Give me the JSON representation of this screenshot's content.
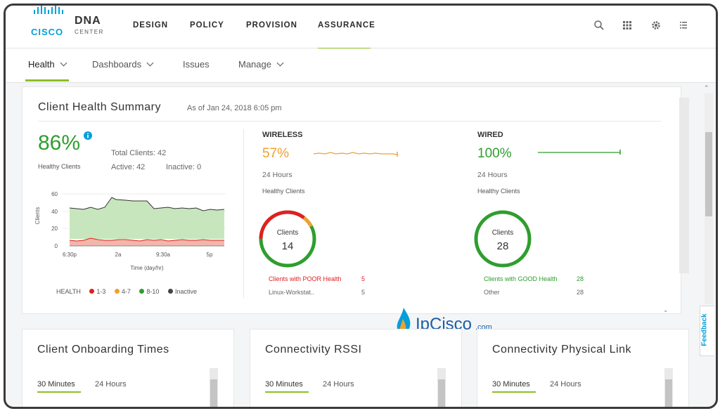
{
  "header": {
    "brand_cisco": "CISCO",
    "brand_dna": "DNA",
    "brand_center": "CENTER",
    "nav": [
      "DESIGN",
      "POLICY",
      "PROVISION",
      "ASSURANCE"
    ],
    "active_nav": "ASSURANCE"
  },
  "subnav": {
    "items": [
      "Health",
      "Dashboards",
      "Issues",
      "Manage"
    ]
  },
  "summary": {
    "title": "Client Health Summary",
    "asof": "As of Jan 24, 2018 6:05 pm",
    "percent": "86%",
    "healthy_label": "Healthy Clients",
    "total_clients": "Total Clients: 42",
    "active": "Active: 42",
    "inactive": "Inactive: 0",
    "chart": {
      "ylabel": "Clients",
      "xlabel": "Time (day/hr)",
      "yticks": [
        "60",
        "40",
        "20",
        "0"
      ],
      "xticks": [
        "6:30p",
        "2a",
        "9:30a",
        "5p"
      ],
      "legend_title": "HEALTH",
      "legend": [
        "1-3",
        "4-7",
        "8-10",
        "Inactive"
      ]
    },
    "wireless": {
      "heading": "WIRELESS",
      "percent": "57%",
      "period": "24 Hours",
      "label": "Healthy Clients",
      "donut_label": "Clients",
      "donut_value": "14",
      "row1_label": "Clients with POOR Health",
      "row1_value": "5",
      "row2_label": "Linux-Workstat..",
      "row2_value": "5"
    },
    "wired": {
      "heading": "WIRED",
      "percent": "100%",
      "period": "24 Hours",
      "label": "Healthy Clients",
      "donut_label": "Clients",
      "donut_value": "28",
      "row1_label": "Clients with GOOD Health",
      "row1_value": "28",
      "row2_label": "Other",
      "row2_value": "28"
    }
  },
  "watermark": {
    "text": "IpCisco",
    "suffix": ".com"
  },
  "cards": [
    {
      "title": "Client Onboarding Times",
      "tab1": "30 Minutes",
      "tab2": "24 Hours"
    },
    {
      "title": "Connectivity RSSI",
      "tab1": "30 Minutes",
      "tab2": "24 Hours"
    },
    {
      "title": "Connectivity Physical Link",
      "tab1": "30 Minutes",
      "tab2": "24 Hours"
    }
  ],
  "feedback": "Feedback",
  "icons": {
    "search": "search-icon",
    "apps": "apps-grid-icon",
    "settings": "gear-icon",
    "menu": "list-icon",
    "info": "info-icon"
  },
  "colors": {
    "accent": "#8cbf26",
    "good": "#2e9e2e",
    "fair": "#f0a030",
    "poor": "#e02020",
    "brand": "#049fd9"
  }
}
